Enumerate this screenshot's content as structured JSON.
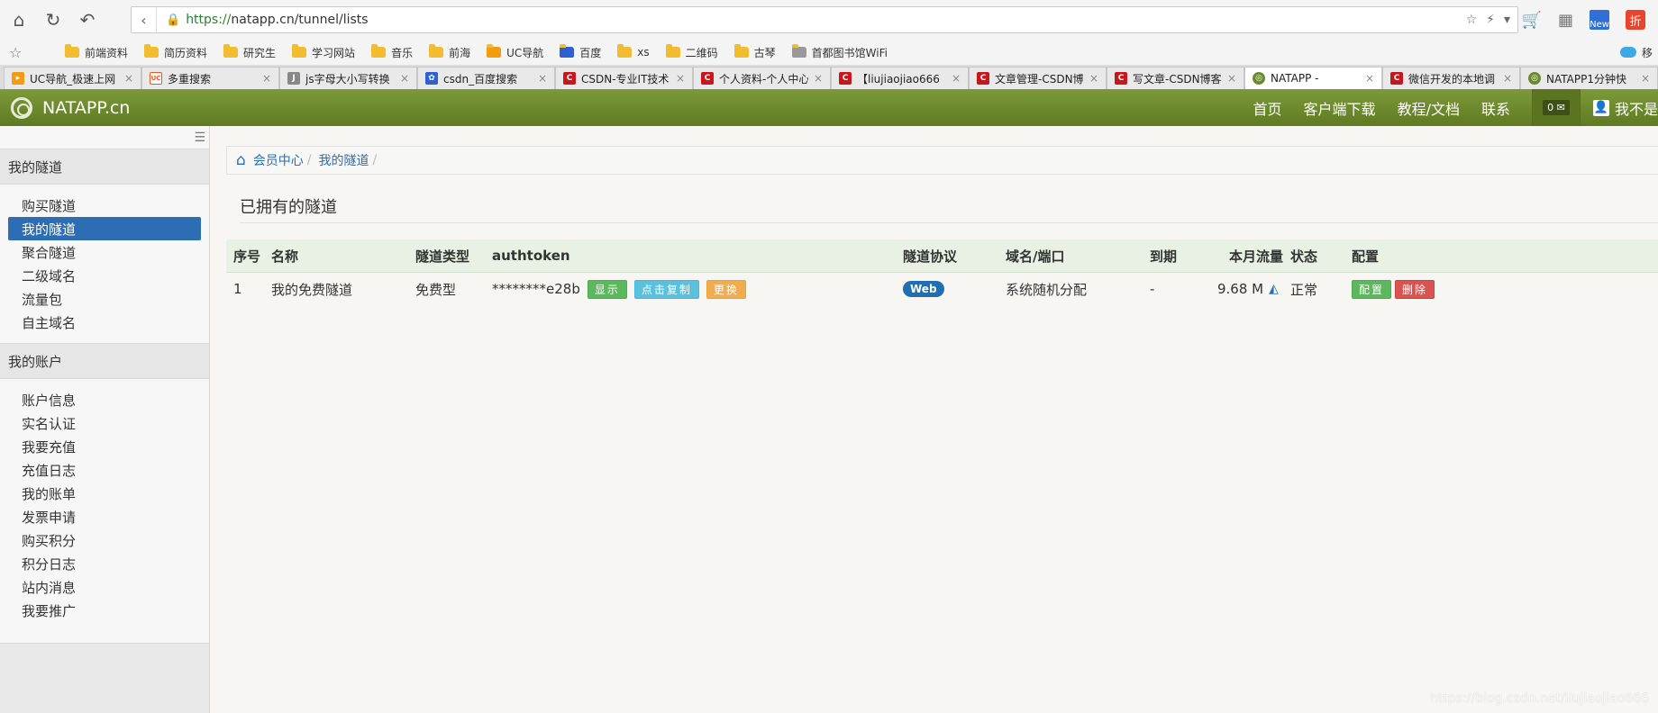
{
  "browser": {
    "url_proto": "https://",
    "url_rest": "natapp.cn/tunnel/lists",
    "new_badge": "New",
    "zhe": "折",
    "bookmarks": [
      "前端资料",
      "简历资料",
      "研究生",
      "学习网站",
      "音乐",
      "前海",
      "UC导航",
      "百度",
      "xs",
      "二维码",
      "古琴",
      "首都图书馆WiFi"
    ],
    "bm_right": "移",
    "tabs": [
      {
        "label": "UC导航_极速上网",
        "icon": "orange"
      },
      {
        "label": "多重搜索",
        "icon": "uc"
      },
      {
        "label": "js字母大小写转换",
        "icon": "js"
      },
      {
        "label": "csdn_百度搜索",
        "icon": "baidu"
      },
      {
        "label": "CSDN-专业IT技术",
        "icon": "csdn"
      },
      {
        "label": "个人资料-个人中心",
        "icon": "csdn"
      },
      {
        "label": "【liujiaojiao666",
        "icon": "csdn"
      },
      {
        "label": "文章管理-CSDN博",
        "icon": "csdn"
      },
      {
        "label": "写文章-CSDN博客",
        "icon": "csdn"
      },
      {
        "label": "NATAPP -",
        "icon": "nat",
        "active": true
      },
      {
        "label": "微信开发的本地调",
        "icon": "csdn"
      },
      {
        "label": "NATAPP1分钟快",
        "icon": "nat"
      }
    ]
  },
  "site": {
    "brand": "NATAPP.cn",
    "nav": [
      "首页",
      "客户端下载",
      "教程/文档",
      "联系"
    ],
    "msg_count": "0",
    "user": "我不是"
  },
  "sidebar": {
    "section1": "我的隧道",
    "items1": [
      "购买隧道",
      "我的隧道",
      "聚合隧道",
      "二级域名",
      "流量包",
      "自主域名"
    ],
    "section2": "我的账户",
    "items2": [
      "账户信息",
      "实名认证",
      "我要充值",
      "充值日志",
      "我的账单",
      "发票申请",
      "购买积分",
      "积分日志",
      "站内消息",
      "我要推广"
    ]
  },
  "breadcrumb": [
    "会员中心",
    "我的隧道"
  ],
  "page_title": "已拥有的隧道",
  "table": {
    "headers": [
      "序号",
      "名称",
      "隧道类型",
      "authtoken",
      "隧道协议",
      "域名/端口",
      "到期",
      "本月流量",
      "状态",
      "配置"
    ],
    "rows": [
      {
        "index": "1",
        "name": "我的免费隧道",
        "type": "免费型",
        "authtoken": "********e28b",
        "btn_show": "显示",
        "btn_copy": "点击复制",
        "btn_change": "更换",
        "protocol": "Web",
        "domain": "系统随机分配",
        "expire": "-",
        "traffic": "9.68 M",
        "status": "正常",
        "btn_config": "配置",
        "btn_delete": "删除"
      }
    ]
  },
  "watermark": "https://blog.csdn.net/liujiaojiao666"
}
